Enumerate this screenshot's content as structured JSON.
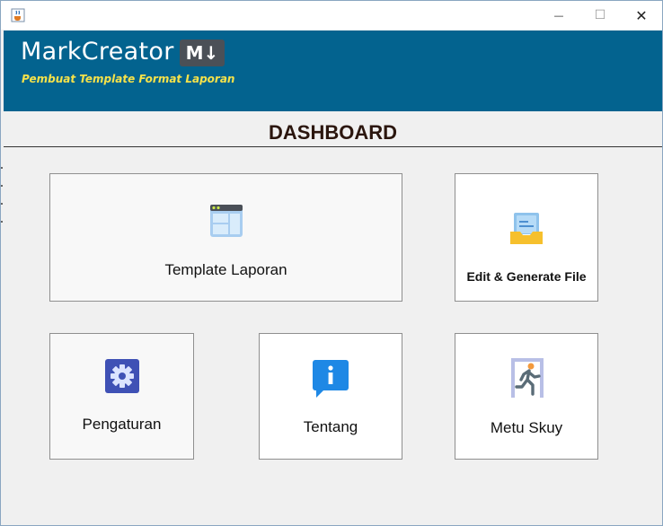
{
  "window": {
    "icon": "java-cup-icon",
    "minimize_glyph": "—",
    "maximize_glyph": "☐",
    "close_glyph": "✕"
  },
  "header": {
    "brand": "MarkCreator",
    "badge": "M↓",
    "subtitle": "Pembuat Template Format Laporan",
    "bg_color": "#03638f",
    "subtitle_color": "#f6e24a"
  },
  "dashboard": {
    "title": "DASHBOARD"
  },
  "cards": {
    "template": {
      "label": "Template Laporan",
      "icon": "browser-window-icon"
    },
    "edit": {
      "label": "Edit & Generate File",
      "icon": "document-tray-icon"
    },
    "settings": {
      "label": "Pengaturan",
      "icon": "gear-icon"
    },
    "about": {
      "label": "Tentang",
      "icon": "info-chat-icon"
    },
    "exit": {
      "label": "Metu Skuy",
      "icon": "exit-running-man-icon"
    }
  }
}
